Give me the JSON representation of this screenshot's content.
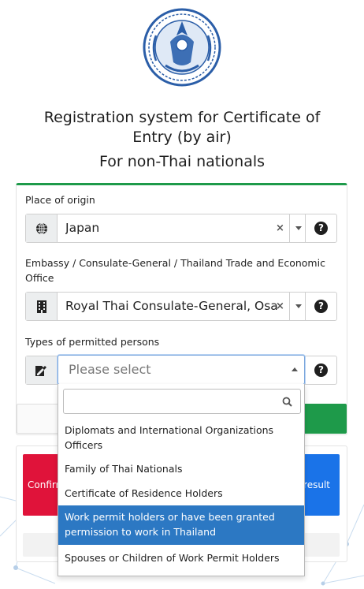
{
  "header": {
    "title_line1": "Registration system for Certificate of",
    "title_line2": "Entry (by air)",
    "subtitle": "For non-Thai nationals"
  },
  "form": {
    "origin": {
      "label": "Place of origin",
      "value": "Japan",
      "icon": "globe-icon"
    },
    "embassy": {
      "label_line1": "Embassy / Consulate-General / Thailand Trade and Economic",
      "label_line2": "Office",
      "value": "Royal Thai Consulate-General, Osaka",
      "icon": "building-icon"
    },
    "permitted": {
      "label": "Types of permitted persons",
      "placeholder": "Please select",
      "icon": "edit-document-icon"
    },
    "clear_glyph": "×",
    "help_glyph": "?"
  },
  "dropdown": {
    "search_value": "",
    "options": [
      {
        "line1": "Diplomats and International Organizations",
        "line2": "Officers"
      },
      {
        "line1": "Family of Thai Nationals",
        "line2": ""
      },
      {
        "line1": "Certificate of Residence Holders",
        "line2": ""
      },
      {
        "line1": "Work permit holders or have been granted",
        "line2": "permission to work in Thailand"
      },
      {
        "line1": "Spouses or Children of Work Permit Holders",
        "line2": ""
      }
    ],
    "highlighted_index": 3
  },
  "buttons": {
    "confirm_partial": "Confirm",
    "result_partial": "result"
  },
  "colors": {
    "accent_green": "#1e9a4a",
    "confirm_red": "#e0133a",
    "result_blue": "#1a73e8",
    "highlight_blue": "#2c78c3"
  }
}
